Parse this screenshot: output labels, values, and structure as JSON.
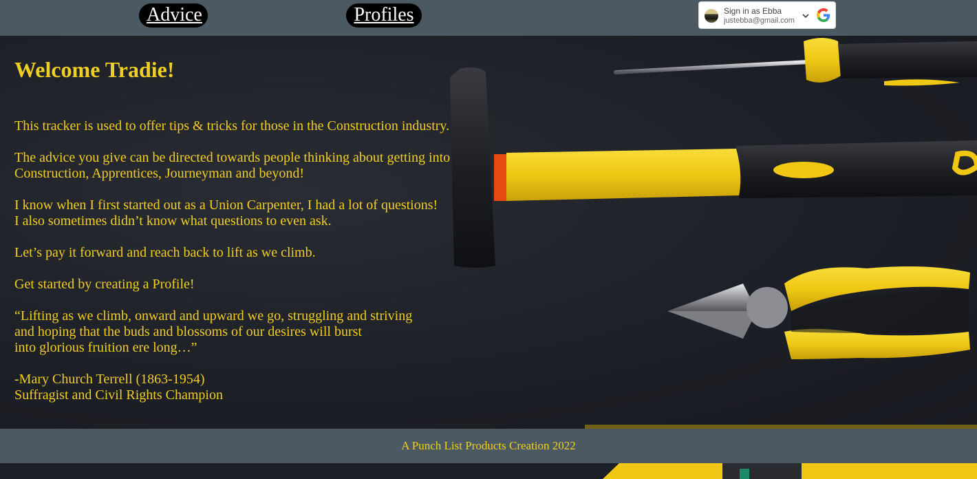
{
  "nav": {
    "advice_label": "Advice",
    "profiles_label": "Profiles"
  },
  "google_signin": {
    "title": "Sign in as Ebba",
    "email": "justebba@gmail.com",
    "icon": "google-logo"
  },
  "hero": {
    "title": "Welcome Tradie!",
    "paragraphs": [
      [
        "This tracker is used to offer tips & tricks for those in the Construction industry."
      ],
      [
        "The advice you give can be directed towards people thinking about getting into",
        "Construction, Apprentices, Journeyman and beyond!"
      ],
      [
        "I know when I first started out as a Union Carpenter, I had a lot of questions!",
        "I also sometimes didn’t know what questions to even ask."
      ],
      [
        "Let’s pay it forward and reach back to lift as we climb."
      ],
      [
        "Get started by creating a Profile!"
      ],
      [
        "“Lifting as we climb, onward and upward we go, struggling and striving",
        "and hoping that the buds and blossoms of our desires will burst",
        "into glorious fruition ere long…”"
      ],
      [
        "-Mary Church Terrell (1863-1954)",
        "Suffragist and Civil Rights Champion"
      ]
    ]
  },
  "footer": {
    "text": "A Punch List Products Creation 2022"
  },
  "colors": {
    "accent": "#f0ce24",
    "navbar": "#4b5963",
    "background": "#20222a"
  }
}
